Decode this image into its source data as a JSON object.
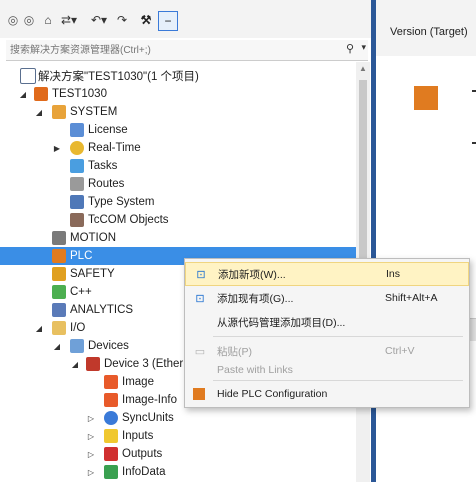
{
  "toolbar": {
    "icons": [
      "back-icon",
      "forward-icon",
      "home-icon",
      "sync-icon",
      "undo-icon",
      "redo-icon",
      "properties-icon",
      "minus-icon"
    ]
  },
  "search": {
    "placeholder": "搜索解决方案资源管理器(Ctrl+;)"
  },
  "tree": [
    {
      "label": "解决方案\"TEST1030\"(1 个项目)",
      "icon": "solution-icon",
      "color": "#5a6f8f"
    },
    {
      "label": "TEST1030",
      "icon": "project-icon",
      "color": "#e06a1b"
    },
    {
      "label": "SYSTEM",
      "icon": "system-icon",
      "color": "#e8a33a"
    },
    {
      "label": "License",
      "icon": "license-icon",
      "color": "#5b8ed6"
    },
    {
      "label": "Real-Time",
      "icon": "realtime-icon",
      "color": "#e8b830"
    },
    {
      "label": "Tasks",
      "icon": "tasks-icon",
      "color": "#4a9ee0"
    },
    {
      "label": "Routes",
      "icon": "routes-icon",
      "color": "#777777"
    },
    {
      "label": "Type System",
      "icon": "type-system-icon",
      "color": "#4f78b8"
    },
    {
      "label": "TcCOM Objects",
      "icon": "tccom-icon",
      "color": "#8a6a5a"
    },
    {
      "label": "MOTION",
      "icon": "motion-icon",
      "color": "#7a7a7a"
    },
    {
      "label": "PLC",
      "icon": "plc-icon",
      "color": "#e07b20"
    },
    {
      "label": "SAFETY",
      "icon": "safety-icon",
      "color": "#e0a020"
    },
    {
      "label": "C++",
      "icon": "cpp-icon",
      "color": "#4caf50"
    },
    {
      "label": "ANALYTICS",
      "icon": "analytics-icon",
      "color": "#5a7ab8"
    },
    {
      "label": "I/O",
      "icon": "io-icon",
      "color": "#e8c060"
    },
    {
      "label": "Devices",
      "icon": "devices-icon",
      "color": "#6fa0d8"
    },
    {
      "label": "Device 3 (Ether",
      "icon": "device-icon",
      "color": "#c0392b"
    },
    {
      "label": "Image",
      "icon": "image-icon",
      "color": "#e85a2a"
    },
    {
      "label": "Image-Info",
      "icon": "image-info-icon",
      "color": "#e85a2a"
    },
    {
      "label": "SyncUnits",
      "icon": "syncunits-icon",
      "color": "#3a7ad8"
    },
    {
      "label": "Inputs",
      "icon": "inputs-icon",
      "color": "#f0c830"
    },
    {
      "label": "Outputs",
      "icon": "outputs-icon",
      "color": "#d03030"
    },
    {
      "label": "InfoData",
      "icon": "infodata-icon",
      "color": "#3aa050"
    }
  ],
  "right": {
    "title": "Version (Target)"
  },
  "menu": [
    {
      "label": "添加新项(W)...",
      "shortcut": "Ins",
      "icon": "add-new-item-icon"
    },
    {
      "label": "添加现有项(G)...",
      "shortcut": "Shift+Alt+A",
      "icon": "add-existing-item-icon"
    },
    {
      "label": "从源代码管理添加项目(D)...",
      "shortcut": "",
      "icon": ""
    },
    {
      "label": "粘贴(P)",
      "shortcut": "Ctrl+V",
      "icon": "paste-icon"
    },
    {
      "label": "Paste with Links",
      "shortcut": "",
      "icon": ""
    },
    {
      "label": "Hide PLC Configuration",
      "shortcut": "",
      "icon": "hide-plc-icon"
    }
  ]
}
